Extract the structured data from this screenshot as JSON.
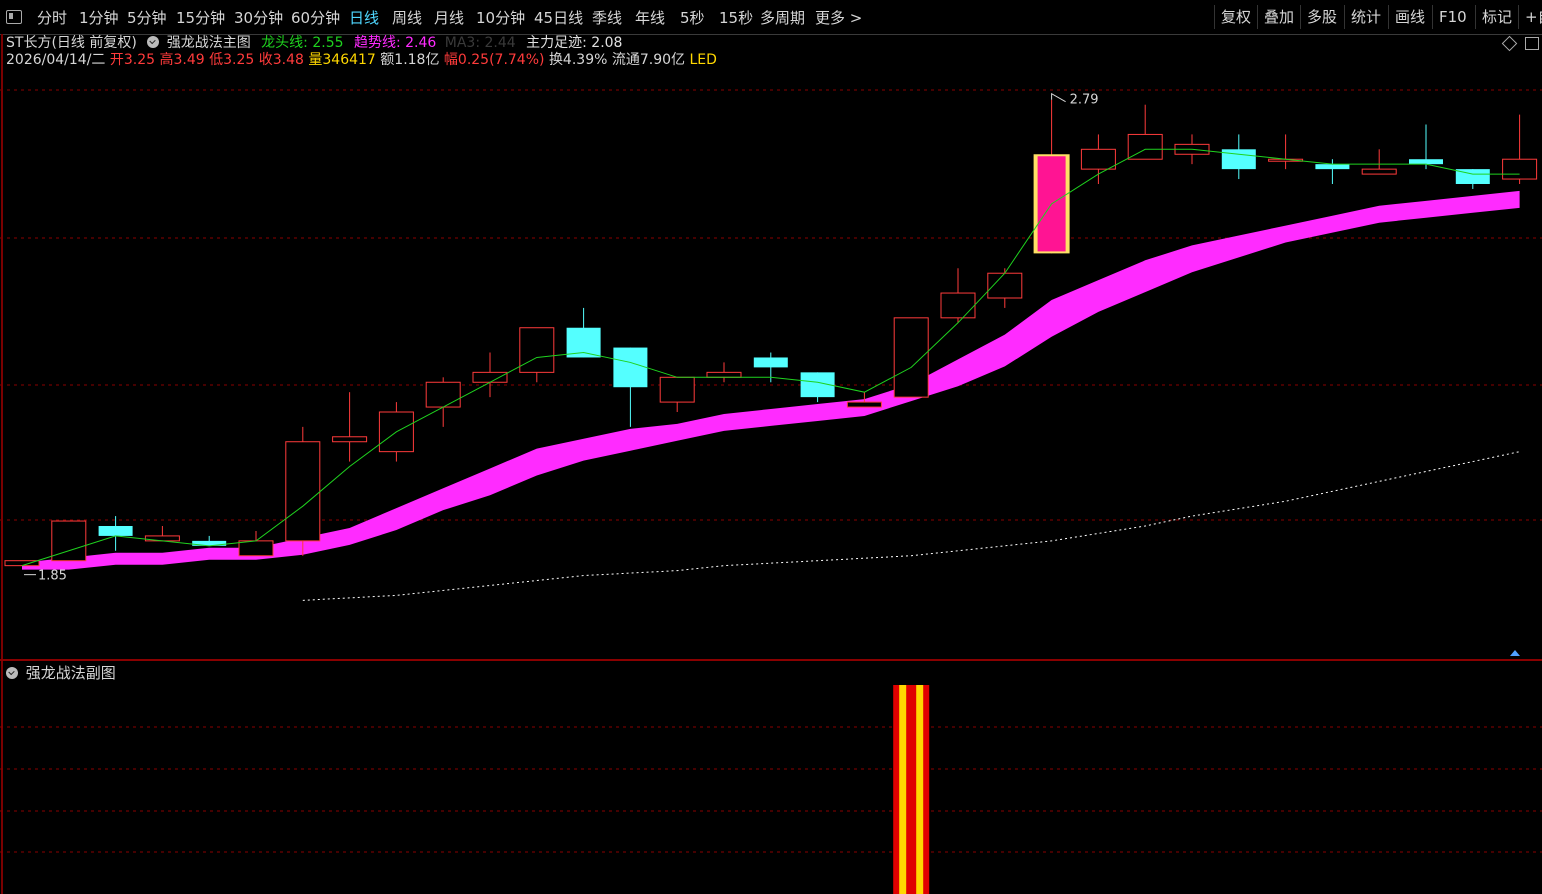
{
  "toolbar": {
    "periods": [
      "分时",
      "1分钟",
      "5分钟",
      "15分钟",
      "30分钟",
      "60分钟",
      "日线",
      "周线",
      "月线",
      "10分钟",
      "45日线",
      "季线",
      "年线",
      "5秒",
      "15秒",
      "多周期",
      "更多 >"
    ],
    "active_period": "日线",
    "right_buttons": [
      "复权",
      "叠加",
      "多股",
      "统计",
      "画线",
      "F10",
      "标记",
      "+自"
    ]
  },
  "header": {
    "stock": "ST长方(日线 前复权)",
    "main_indicator": "强龙战法主图",
    "dragon_label": "龙头线: 2.55",
    "trend_label": "趋势线: 2.46",
    "ma_label": "MA3: 2.44",
    "main_force_label": "主力足迹: 2.08"
  },
  "quote": {
    "date": "2026/04/14/二",
    "open_label": "开",
    "open": "3.25",
    "high_label": "高",
    "high": "3.49",
    "low_label": "低",
    "low": "3.25",
    "close_label": "收",
    "close": "3.48",
    "volume_label": "量",
    "volume": "346417",
    "amount": "额1.18亿",
    "change_label": "幅",
    "change": "0.25(7.74%)",
    "turnover": "换4.39%",
    "float_cap": "流通7.90亿",
    "tag": "LED"
  },
  "sub_panel": {
    "title": "强龙战法副图"
  },
  "colors": {
    "up": "#ff3b3b",
    "down": "#54ffff",
    "dragon": "#1fd21f",
    "trend": "#ff2bff",
    "ma": "#ffffff",
    "grid": "#8a0000",
    "limit_up": "#ff1493",
    "limit_edge": "#ffe066"
  },
  "chart_data": {
    "type": "candlestick",
    "price_range": [
      1.7,
      2.85
    ],
    "max_label": "2.79",
    "min_label": "1.85",
    "candles": [
      {
        "o": 1.85,
        "c": 1.86,
        "h": 1.86,
        "l": 1.85
      },
      {
        "o": 1.86,
        "c": 1.94,
        "h": 1.94,
        "l": 1.86
      },
      {
        "o": 1.93,
        "c": 1.91,
        "h": 1.95,
        "l": 1.88
      },
      {
        "o": 1.9,
        "c": 1.91,
        "h": 1.93,
        "l": 1.9
      },
      {
        "o": 1.9,
        "c": 1.89,
        "h": 1.91,
        "l": 1.89
      },
      {
        "o": 1.87,
        "c": 1.9,
        "h": 1.92,
        "l": 1.87
      },
      {
        "o": 1.9,
        "c": 2.1,
        "h": 2.13,
        "l": 1.87
      },
      {
        "o": 2.1,
        "c": 2.11,
        "h": 2.2,
        "l": 2.06
      },
      {
        "o": 2.08,
        "c": 2.16,
        "h": 2.18,
        "l": 2.06
      },
      {
        "o": 2.17,
        "c": 2.22,
        "h": 2.23,
        "l": 2.13
      },
      {
        "o": 2.22,
        "c": 2.24,
        "h": 2.28,
        "l": 2.19
      },
      {
        "o": 2.24,
        "c": 2.33,
        "h": 2.33,
        "l": 2.22
      },
      {
        "o": 2.33,
        "c": 2.27,
        "h": 2.37,
        "l": 2.27
      },
      {
        "o": 2.29,
        "c": 2.21,
        "h": 2.29,
        "l": 2.13
      },
      {
        "o": 2.18,
        "c": 2.23,
        "h": 2.23,
        "l": 2.16
      },
      {
        "o": 2.23,
        "c": 2.24,
        "h": 2.26,
        "l": 2.22
      },
      {
        "o": 2.27,
        "c": 2.25,
        "h": 2.28,
        "l": 2.22
      },
      {
        "o": 2.24,
        "c": 2.19,
        "h": 2.24,
        "l": 2.18
      },
      {
        "o": 2.17,
        "c": 2.18,
        "h": 2.2,
        "l": 2.17
      },
      {
        "o": 2.19,
        "c": 2.35,
        "h": 2.35,
        "l": 2.19
      },
      {
        "o": 2.35,
        "c": 2.4,
        "h": 2.45,
        "l": 2.34
      },
      {
        "o": 2.39,
        "c": 2.44,
        "h": 2.45,
        "l": 2.37
      },
      {
        "o": 2.48,
        "c": 2.68,
        "h": 2.79,
        "l": 2.48,
        "limit_up": true
      },
      {
        "o": 2.65,
        "c": 2.69,
        "h": 2.72,
        "l": 2.62
      },
      {
        "o": 2.67,
        "c": 2.72,
        "h": 2.78,
        "l": 2.67
      },
      {
        "o": 2.68,
        "c": 2.7,
        "h": 2.72,
        "l": 2.66
      },
      {
        "o": 2.69,
        "c": 2.65,
        "h": 2.72,
        "l": 2.63
      },
      {
        "o": 2.67,
        "c": 2.67,
        "h": 2.72,
        "l": 2.65
      },
      {
        "o": 2.66,
        "c": 2.65,
        "h": 2.67,
        "l": 2.62
      },
      {
        "o": 2.64,
        "c": 2.65,
        "h": 2.69,
        "l": 2.64
      },
      {
        "o": 2.67,
        "c": 2.66,
        "h": 2.74,
        "l": 2.65
      },
      {
        "o": 2.65,
        "c": 2.62,
        "h": 2.65,
        "l": 2.61
      },
      {
        "o": 2.63,
        "c": 2.67,
        "h": 2.76,
        "l": 2.62
      }
    ],
    "dragon_line": [
      1.85,
      1.88,
      1.91,
      1.9,
      1.89,
      1.9,
      1.97,
      2.05,
      2.12,
      2.17,
      2.22,
      2.27,
      2.28,
      2.26,
      2.23,
      2.23,
      2.23,
      2.22,
      2.2,
      2.25,
      2.34,
      2.44,
      2.58,
      2.64,
      2.69,
      2.69,
      2.68,
      2.67,
      2.66,
      2.66,
      2.66,
      2.64,
      2.64
    ],
    "trend_upper": [
      1.85,
      1.86,
      1.87,
      1.87,
      1.88,
      1.88,
      1.9,
      1.92,
      1.96,
      2.0,
      2.04,
      2.08,
      2.1,
      2.12,
      2.13,
      2.15,
      2.16,
      2.17,
      2.18,
      2.21,
      2.26,
      2.31,
      2.38,
      2.42,
      2.46,
      2.49,
      2.51,
      2.53,
      2.55,
      2.57,
      2.58,
      2.59,
      2.6
    ],
    "trend_lower": [
      1.85,
      1.85,
      1.86,
      1.86,
      1.87,
      1.87,
      1.88,
      1.9,
      1.93,
      1.97,
      2.0,
      2.04,
      2.07,
      2.09,
      2.11,
      2.13,
      2.14,
      2.15,
      2.16,
      2.19,
      2.22,
      2.26,
      2.32,
      2.37,
      2.41,
      2.45,
      2.48,
      2.51,
      2.53,
      2.55,
      2.56,
      2.57,
      2.58
    ],
    "ma_dotted": [
      null,
      null,
      null,
      null,
      null,
      null,
      1.78,
      1.785,
      1.79,
      1.8,
      1.81,
      1.82,
      1.83,
      1.835,
      1.84,
      1.85,
      1.855,
      1.86,
      1.865,
      1.87,
      1.88,
      1.89,
      1.9,
      1.915,
      1.93,
      1.95,
      1.965,
      1.98,
      2.0,
      2.02,
      2.04,
      2.06,
      2.08
    ],
    "sub_signal": {
      "index": 19,
      "label": ""
    }
  }
}
